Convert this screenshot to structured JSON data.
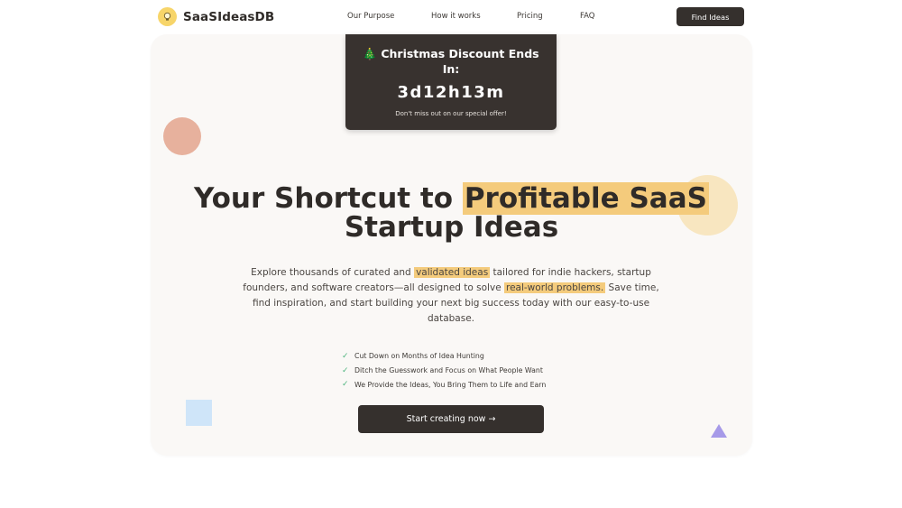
{
  "nav": {
    "brand": "SaaSIdeasDB",
    "links": [
      "Our Purpose",
      "How it works",
      "Pricing",
      "FAQ"
    ],
    "cta": "Find Ideas"
  },
  "promo": {
    "title": "🎄 Christmas Discount Ends In:",
    "timer": "3d12h13m",
    "note": "Don't miss out on our special offer!"
  },
  "hero": {
    "headline_pre": "Your Shortcut to ",
    "headline_highlight": "Profitable SaaS",
    "headline_post": " Startup Ideas",
    "desc_1": "Explore thousands of curated and ",
    "desc_mark_1": "validated ideas",
    "desc_2": " tailored for indie hackers, startup founders, and software creators—all designed to solve ",
    "desc_mark_2": "real-world problems.",
    "desc_3": " Save time, find inspiration, and start building your next big success today with our easy-to-use database.",
    "benefits": [
      "Cut Down on Months of Idea Hunting",
      "Ditch the Guesswork and Focus on What People Want",
      "We Provide the Ideas, You Bring Them to Life and Earn"
    ],
    "cta": "Start creating now →"
  },
  "icons": {
    "logo": "lightbulb-icon",
    "check": "check-icon"
  },
  "colors": {
    "dark": "#35302d",
    "highlight": "#f4cb7c",
    "check": "#4fb47f"
  }
}
